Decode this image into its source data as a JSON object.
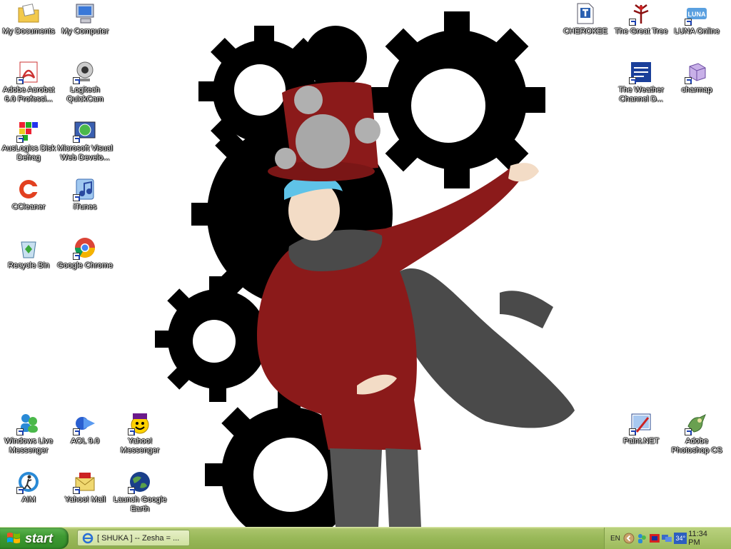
{
  "desktop": {
    "icons": [
      {
        "label": "My Documents",
        "icon": "folder-documents-icon"
      },
      {
        "label": "My Computer",
        "icon": "computer-icon"
      },
      {
        "label": "Adobe Acrobat 6.0 Professi...",
        "icon": "acrobat-icon"
      },
      {
        "label": "Logitech QuickCam",
        "icon": "webcam-icon"
      },
      {
        "label": "AusLogics Disk Defrag",
        "icon": "defrag-icon"
      },
      {
        "label": "Microsoft Visual Web Develo...",
        "icon": "visual-web-icon"
      },
      {
        "label": "CCleaner",
        "icon": "ccleaner-icon"
      },
      {
        "label": "iTunes",
        "icon": "itunes-icon"
      },
      {
        "label": "Recycle Bin",
        "icon": "recycle-bin-icon"
      },
      {
        "label": "Google Chrome",
        "icon": "chrome-icon"
      },
      {
        "label": "Windows Live Messenger",
        "icon": "messenger-icon"
      },
      {
        "label": "AOL 9.0",
        "icon": "aol-icon"
      },
      {
        "label": "Yahoo! Messenger",
        "icon": "yahoo-messenger-icon"
      },
      {
        "label": "AIM",
        "icon": "aim-icon"
      },
      {
        "label": "Yahoo! Mail",
        "icon": "yahoo-mail-icon"
      },
      {
        "label": "Launch Google Earth",
        "icon": "google-earth-icon"
      },
      {
        "label": "CHEROKEE",
        "icon": "font-file-icon"
      },
      {
        "label": "The Great Tree",
        "icon": "great-tree-icon"
      },
      {
        "label": "LUNA Online",
        "icon": "luna-online-icon"
      },
      {
        "label": "The Weather Channel D...",
        "icon": "weather-channel-icon"
      },
      {
        "label": "charmap",
        "icon": "charmap-icon"
      },
      {
        "label": "Paint.NET",
        "icon": "paintnet-icon"
      },
      {
        "label": "Adobe Photoshop CS",
        "icon": "photoshop-icon"
      }
    ]
  },
  "taskbar": {
    "start_label": "start",
    "task_label": "[ SHUKA ] -- Zesha = ...",
    "tray": {
      "language": "EN",
      "temperature": "34°",
      "time": "11:34 PM"
    }
  },
  "colors": {
    "taskbar": "#98b858",
    "start_button": "#3f9a33",
    "wallpaper_red": "#8b1a1a",
    "wallpaper_gear": "#000000"
  }
}
